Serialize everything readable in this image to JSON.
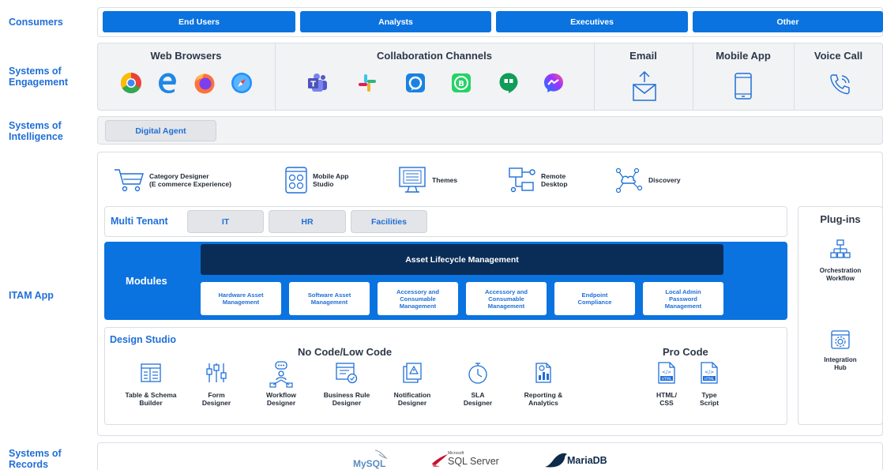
{
  "labels": {
    "consumers": "Consumers",
    "engagement": "Systems of\nEngagement",
    "intelligence": "Systems of\nIntelligence",
    "itam": "ITAM App",
    "records": "Systems of\nRecords"
  },
  "consumers": [
    "End Users",
    "Analysts",
    "Executives",
    "Other"
  ],
  "engagement": {
    "web_browsers": "Web Browsers",
    "collaboration": "Collaboration Channels",
    "email": "Email",
    "mobile_app": "Mobile App",
    "voice_call": "Voice Call"
  },
  "intelligence": {
    "digital_agent": "Digital Agent"
  },
  "tools": {
    "category_designer": "Category Designer\n(E commerce Experience)",
    "mobile_app_studio": "Mobile App\nStudio",
    "themes": "Themes",
    "remote_desktop": "Remote\nDesktop",
    "discovery": "Discovery"
  },
  "multi_tenant": {
    "title": "Multi Tenant",
    "tenants": [
      "IT",
      "HR",
      "Facilities"
    ]
  },
  "modules": {
    "title": "Modules",
    "alm": "Asset Lifecycle Management",
    "items": [
      "Hardware Asset\nManagement",
      "Software Asset\nManagement",
      "Accessory and\nConsumable\nManagement",
      "Accessory and\nConsumable\nManagement",
      "Endpoint\nCompliance",
      "Local Admin\nPassword\nManagement"
    ]
  },
  "design_studio": {
    "title": "Design Studio",
    "no_code": "No Code/Low Code",
    "pro_code": "Pro Code",
    "tools": [
      "Table & Schema\nBuilder",
      "Form\nDesigner",
      "Workflow\nDesigner",
      "Business Rule\nDesigner",
      "Notification\nDesigner",
      "SLA\nDesigner",
      "Reporting &\nAnalytics"
    ],
    "pro_tools": [
      "HTML/\nCSS",
      "Type\nScript"
    ],
    "html_tag": "HTML"
  },
  "plugins": {
    "title": "Plug-ins",
    "items": [
      "Orchestration\nWorkflow",
      "Integration\nHub"
    ]
  },
  "records": {
    "mysql": "MySQL",
    "sqlserver": "SQL Server",
    "sqlserver_small": "Microsoft",
    "mariadb": "MariaDB"
  },
  "colors": {
    "blue": "#0b73e0",
    "label": "#1f6fd8",
    "navy": "#0a2d57"
  }
}
